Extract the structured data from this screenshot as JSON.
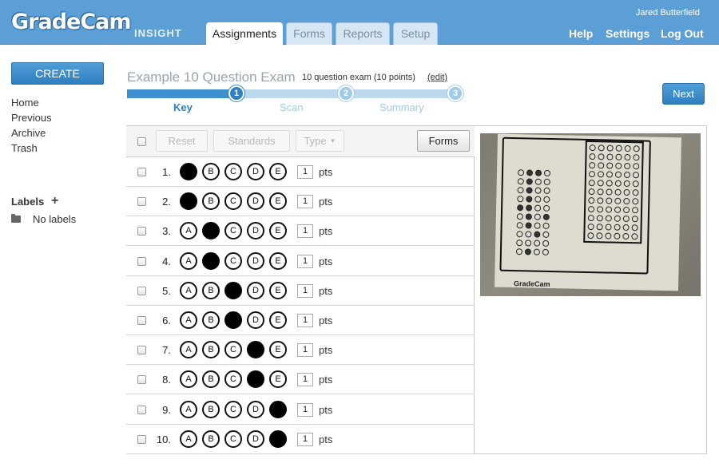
{
  "header": {
    "logo": "GradeCam",
    "logo_sub": "INSIGHT",
    "user_name": "Jared Butterfield",
    "tabs": [
      {
        "label": "Assignments",
        "active": true
      },
      {
        "label": "Forms",
        "active": false
      },
      {
        "label": "Reports",
        "active": false
      },
      {
        "label": "Setup",
        "active": false
      }
    ],
    "links": [
      "Help",
      "Settings",
      "Log Out"
    ]
  },
  "sidebar": {
    "create_label": "CREATE",
    "items": [
      "Home",
      "Previous",
      "Archive",
      "Trash"
    ],
    "labels_title": "Labels",
    "no_labels": "No labels"
  },
  "exam": {
    "title": "Example 10 Question Exam",
    "subtitle": "10 question exam (10 points)",
    "edit_label": "(edit)",
    "next_label": "Next",
    "steps": [
      {
        "num": "1",
        "label": "Key",
        "current": true
      },
      {
        "num": "2",
        "label": "Scan",
        "current": false
      },
      {
        "num": "3",
        "label": "Summary",
        "current": false
      }
    ]
  },
  "toolbar": {
    "reset_label": "Reset",
    "standards_label": "Standards",
    "type_label": "Type",
    "forms_label": "Forms"
  },
  "questions": [
    {
      "num": "1.",
      "answer": "A",
      "pts": "1"
    },
    {
      "num": "2.",
      "answer": "A",
      "pts": "1"
    },
    {
      "num": "3.",
      "answer": "B",
      "pts": "1"
    },
    {
      "num": "4.",
      "answer": "B",
      "pts": "1"
    },
    {
      "num": "5.",
      "answer": "C",
      "pts": "1"
    },
    {
      "num": "6.",
      "answer": "C",
      "pts": "1"
    },
    {
      "num": "7.",
      "answer": "D",
      "pts": "1"
    },
    {
      "num": "8.",
      "answer": "D",
      "pts": "1"
    },
    {
      "num": "9.",
      "answer": "E",
      "pts": "1"
    },
    {
      "num": "10.",
      "answer": "E",
      "pts": "1"
    }
  ],
  "choices": [
    "A",
    "B",
    "C",
    "D",
    "E"
  ],
  "pts_label": "pts",
  "scan_brand": "GradeCam",
  "colors": {
    "header_blue": "#5b9fd6",
    "button_blue": "#2f7fc0",
    "progress_done": "#3d8fd0",
    "progress_todo": "#bcd9ee"
  }
}
